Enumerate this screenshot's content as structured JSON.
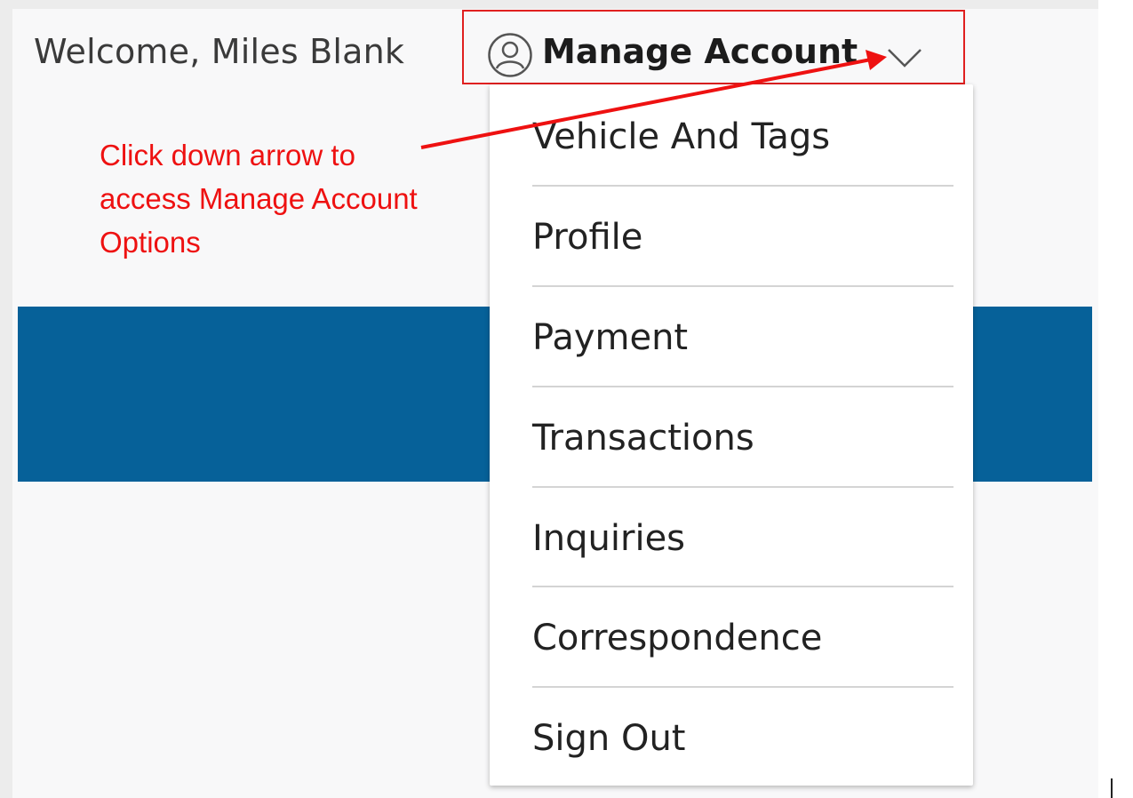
{
  "header": {
    "welcome_text": "Welcome, Miles Blank",
    "manage_account_label": "Manage Account",
    "user_icon": "user-circle-icon",
    "dropdown_icon": "chevron-down-icon"
  },
  "menu": {
    "items": [
      {
        "label": "Vehicle And Tags"
      },
      {
        "label": "Profile"
      },
      {
        "label": "Payment"
      },
      {
        "label": "Transactions"
      },
      {
        "label": "Inquiries"
      },
      {
        "label": "Correspondence"
      },
      {
        "label": "Sign Out"
      }
    ]
  },
  "annotation": {
    "text": "Click down arrow to access Manage Account Options",
    "color": "#ee1111"
  },
  "colors": {
    "band": "#066199",
    "highlight_box": "#e02020"
  }
}
